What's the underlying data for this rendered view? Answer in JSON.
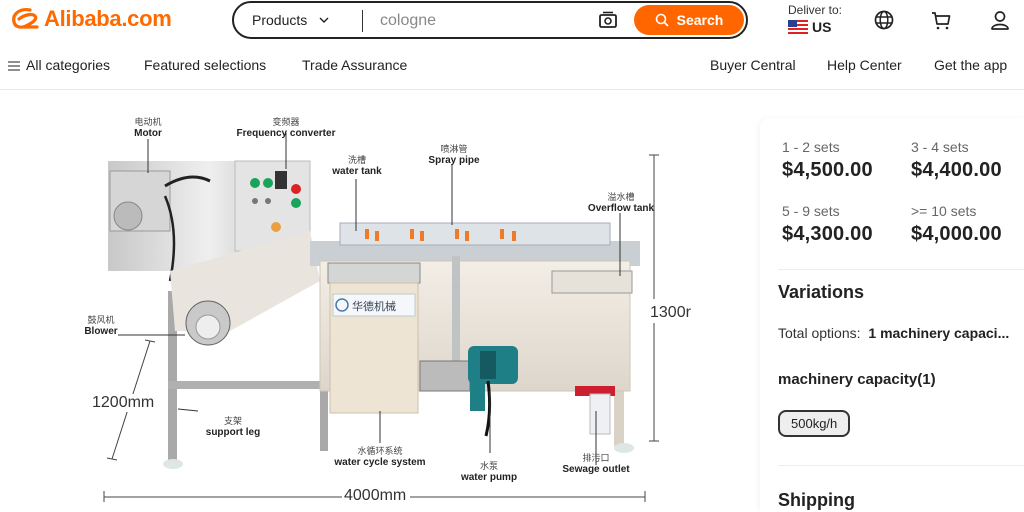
{
  "header": {
    "logo_text": "Alibaba.com",
    "search": {
      "category": "Products",
      "value": "cologne",
      "placeholder": "cologne",
      "button_label": "Search"
    },
    "deliver": {
      "label": "Deliver to:",
      "country": "US"
    },
    "icons": [
      "globe-icon",
      "cart-icon",
      "user-icon"
    ]
  },
  "nav": {
    "left": [
      "All categories",
      "Featured selections",
      "Trade Assurance"
    ],
    "right": [
      "Buyer Central",
      "Help Center",
      "Get the app"
    ]
  },
  "product_image": {
    "labels": [
      {
        "zh": "电动机",
        "en": "Motor"
      },
      {
        "zh": "变频器",
        "en": "Frequency converter"
      },
      {
        "zh": "洗槽",
        "en": "water tank"
      },
      {
        "zh": "喷淋管",
        "en": "Spray pipe"
      },
      {
        "zh": "溢水槽",
        "en": "Overflow tank"
      },
      {
        "zh": "鼓风机",
        "en": "Blower"
      },
      {
        "zh": "支架",
        "en": "support leg"
      },
      {
        "zh": "水循环系统",
        "en": "water cycle system"
      },
      {
        "zh": "水泵",
        "en": "water pump"
      },
      {
        "zh": "排污口",
        "en": "Sewage outlet"
      }
    ],
    "dimensions": {
      "height_left": "1200mm",
      "height_right": "1300r",
      "length": "4000mm"
    },
    "brand_plate": "华德机械"
  },
  "pricing": {
    "tiers": [
      {
        "qty": "1 - 2 sets",
        "price": "$4,500.00"
      },
      {
        "qty": "3 - 4 sets",
        "price": "$4,400.00"
      },
      {
        "qty": "5 - 9 sets",
        "price": "$4,300.00"
      },
      {
        "qty": ">= 10 sets",
        "price": "$4,000.00"
      }
    ]
  },
  "variations": {
    "title": "Variations",
    "total_label": "Total options:",
    "total_value": "1 machinery capaci...",
    "capacity_title": "machinery capacity(1)",
    "options": [
      "500kg/h"
    ]
  },
  "shipping": {
    "title": "Shipping"
  },
  "colors": {
    "brand": "#ff6a00",
    "search_button": "#ff6600"
  }
}
